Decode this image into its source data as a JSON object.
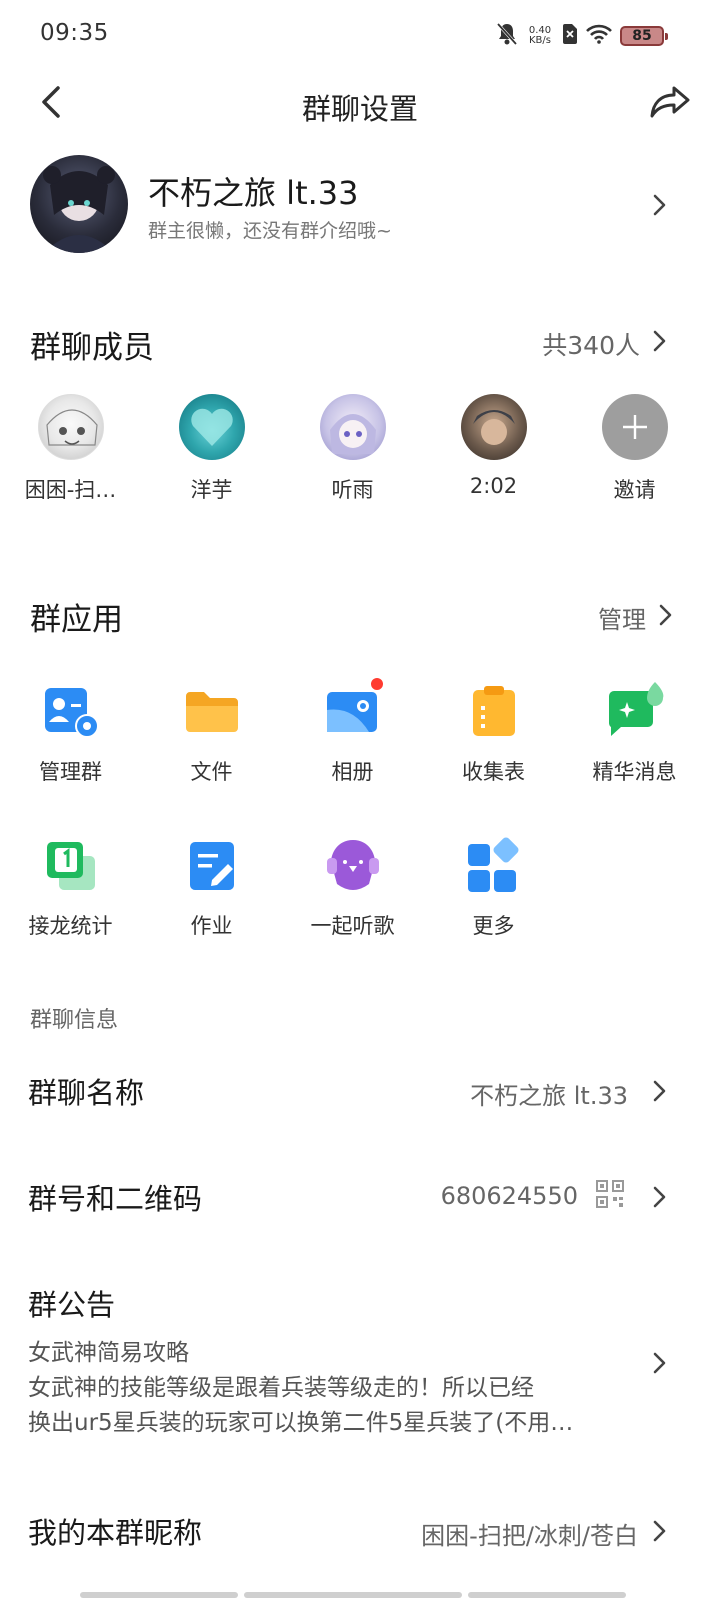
{
  "status_bar": {
    "time": "09:35",
    "speed_value": "0.40",
    "speed_unit": "KB/s",
    "battery": "85"
  },
  "header": {
    "title": "群聊设置"
  },
  "group": {
    "name": "不朽之旅 lt.33",
    "intro": "群主很懒，还没有群介绍哦~"
  },
  "members": {
    "title": "群聊成员",
    "count": "共340人",
    "list": [
      {
        "name": "困困-扫…"
      },
      {
        "name": "洋芋"
      },
      {
        "name": "听雨"
      },
      {
        "name": "2:02"
      },
      {
        "name": "邀请"
      }
    ]
  },
  "apps": {
    "title": "群应用",
    "manage": "管理",
    "row1": [
      {
        "label": "管理群",
        "icon": "manage-group-icon",
        "color": "#2c8cf4"
      },
      {
        "label": "文件",
        "icon": "folder-icon",
        "color": "#ffb830"
      },
      {
        "label": "相册",
        "icon": "album-icon",
        "color": "#2c8cf4"
      },
      {
        "label": "收集表",
        "icon": "clipboard-icon",
        "color": "#ffb830"
      },
      {
        "label": "精华消息",
        "icon": "essence-message-icon",
        "color": "#27c26d"
      }
    ],
    "row2": [
      {
        "label": "接龙统计",
        "icon": "relay-stats-icon",
        "color": "#27c26d"
      },
      {
        "label": "作业",
        "icon": "homework-icon",
        "color": "#2c8cf4"
      },
      {
        "label": "一起听歌",
        "icon": "listen-music-icon",
        "color": "#9b59d9"
      },
      {
        "label": "更多",
        "icon": "more-apps-icon",
        "color": "#2c8cf4"
      }
    ]
  },
  "info": {
    "heading": "群聊信息",
    "group_name_label": "群聊名称",
    "group_name_value": "不朽之旅 lt.33",
    "group_id_label": "群号和二维码",
    "group_id_value": "680624550",
    "notice_label": "群公告",
    "notice_lines": [
      "女武神简易攻略",
      "女武神的技能等级是跟着兵装等级走的！所以已经",
      "换出ur5星兵装的玩家可以换第二件5星兵装了(不用…"
    ],
    "nickname_label": "我的本群昵称",
    "nickname_value": "困困-扫把/冰刺/苍白"
  }
}
